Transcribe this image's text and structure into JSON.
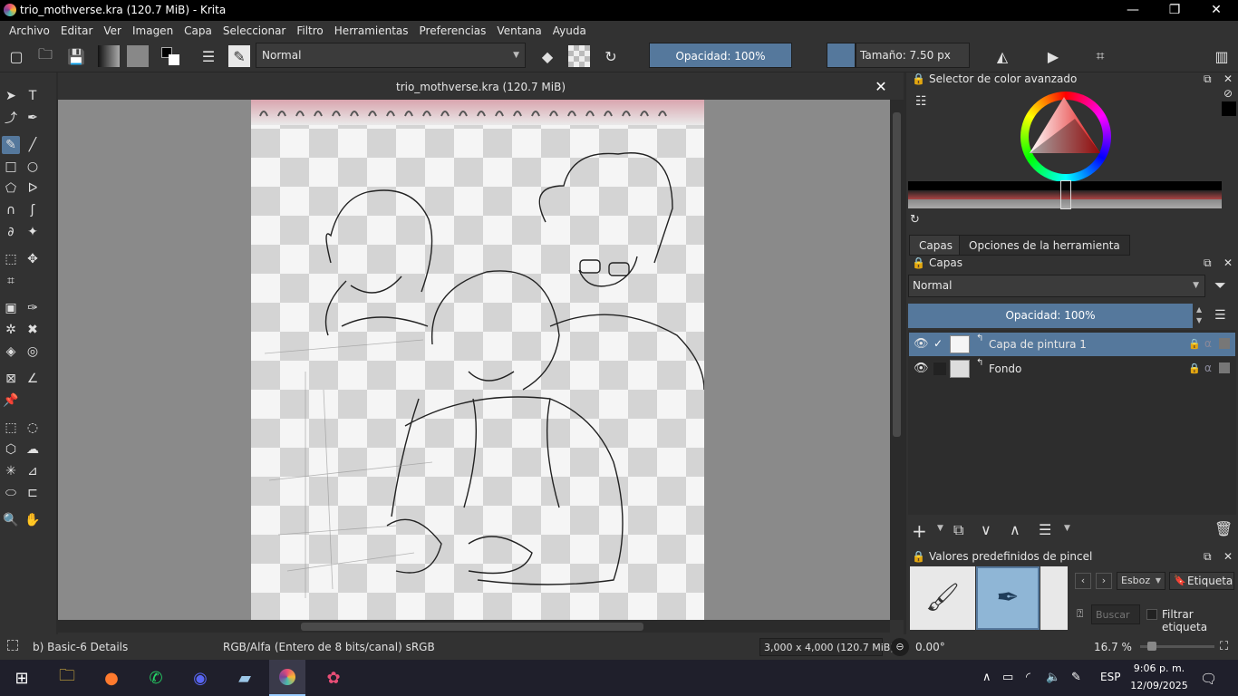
{
  "window": {
    "title": "trio_mothverse.kra (120.7 MiB) - Krita",
    "minimize": "—",
    "maximize": "❐",
    "close": "✕"
  },
  "menu": [
    "Archivo",
    "Editar",
    "Ver",
    "Imagen",
    "Capa",
    "Seleccionar",
    "Filtro",
    "Herramientas",
    "Preferencias",
    "Ventana",
    "Ayuda"
  ],
  "toolbar": {
    "blend_mode": "Normal",
    "opacity": "Opacidad: 100%",
    "size": "Tamaño: 7.50 px"
  },
  "document": {
    "title": "trio_mothverse.kra (120.7 MiB)",
    "close": "✕"
  },
  "color_selector": {
    "title": "Selector de color avanzado"
  },
  "tabs": [
    {
      "label": "Capas",
      "active": true
    },
    {
      "label": "Opciones de la herramienta",
      "active": false
    }
  ],
  "layers_panel": {
    "title": "Capas",
    "blend_mode": "Normal",
    "opacity": "Opacidad:  100%",
    "layers": [
      {
        "name": "Capa de pintura 1",
        "selected": true,
        "checked": true
      },
      {
        "name": "Fondo",
        "selected": false,
        "checked": false
      }
    ]
  },
  "brush_presets": {
    "title": "Valores predefinidos de pincel",
    "tag": "Esboz",
    "tag_button": "Etiqueta",
    "search_placeholder": "Buscar",
    "filter_label": "Filtrar etiqueta"
  },
  "status": {
    "brush": "b) Basic-6 Details",
    "colorspace": "RGB/Alfa (Entero de 8 bits/canal)  sRGB",
    "image_size": "3,000 x 4,000 (120.7 MiB)",
    "rotation": "0.00°",
    "zoom": "16.7 %"
  },
  "taskbar": {
    "lang": "ESP",
    "time": "9:06 p. m.",
    "date": "12/09/2025"
  },
  "colors": {
    "accent": "#55789c",
    "panel": "#323232",
    "taskbar": "#1f1f2b"
  }
}
